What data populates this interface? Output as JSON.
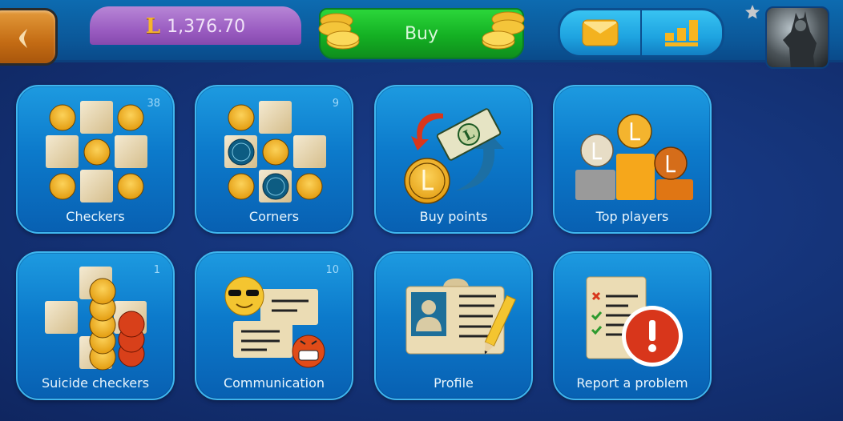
{
  "header": {
    "back_icon": "chevron-left-icon",
    "balance": {
      "currency_icon": "L",
      "amount": "1,376.70"
    },
    "buy_label": "Buy",
    "mail_icon": "envelope-icon",
    "ratings_icon": "bar-chart-icon",
    "rank_icon": "star-icon",
    "avatar": "user-avatar"
  },
  "tiles": [
    {
      "id": "checkers",
      "label": "Checkers",
      "count": "38"
    },
    {
      "id": "corners",
      "label": "Corners",
      "count": "9"
    },
    {
      "id": "buy-points",
      "label": "Buy points",
      "count": ""
    },
    {
      "id": "top-players",
      "label": "Top players",
      "count": ""
    },
    {
      "id": "suicide-checkers",
      "label": "Suicide checkers",
      "count": "1"
    },
    {
      "id": "communication",
      "label": "Communication",
      "count": "10"
    },
    {
      "id": "profile",
      "label": "Profile",
      "count": ""
    },
    {
      "id": "report-problem",
      "label": "Report a problem",
      "count": ""
    }
  ],
  "colors": {
    "background": "#143276",
    "tile": "#0c7acb",
    "buy": "#14b023",
    "balance": "#9a5cc1",
    "back": "#c46c14"
  }
}
